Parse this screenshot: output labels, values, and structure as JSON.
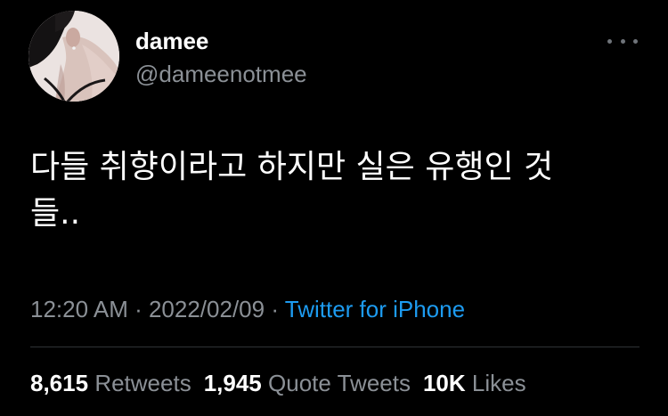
{
  "user": {
    "display_name": "damee",
    "handle": "@dameenotmee"
  },
  "menu": {
    "icon": "more-horizontal-icon"
  },
  "tweet": {
    "text_line1": "다들 취향이라고 하지만 실은 유행인 것",
    "text_line2": "들.."
  },
  "meta": {
    "time": "12:20 AM",
    "sep1": " · ",
    "date": "2022/02/09",
    "sep2": " · ",
    "source": "Twitter for iPhone"
  },
  "stats": {
    "retweets_count": "8,615",
    "retweets_label": "Retweets",
    "quotes_count": "1,945",
    "quotes_label": "Quote Tweets",
    "likes_count": "10K",
    "likes_label": "Likes"
  },
  "colors": {
    "background": "#000000",
    "primary_text": "#ffffff",
    "secondary_text": "#8b9096",
    "link": "#1d9bf0",
    "divider": "#2f3336"
  }
}
